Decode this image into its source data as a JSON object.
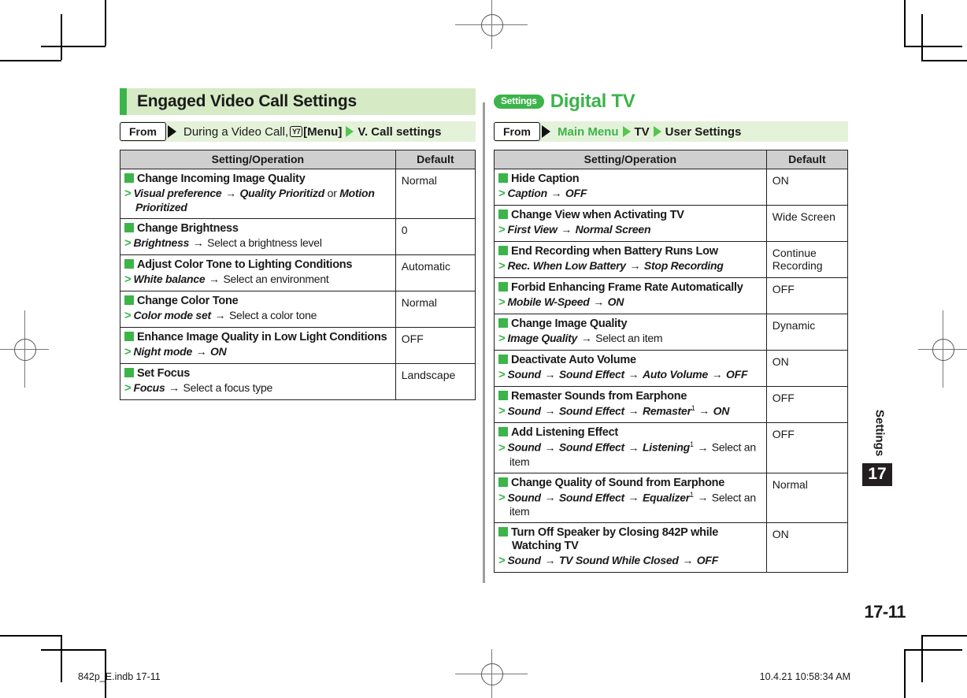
{
  "page": {
    "number": "17-11",
    "side_tab_label": "Settings",
    "side_tab_number": "17",
    "footer_left": "842p_E.indb   17-11",
    "footer_right": "10.4.21   10:58:34 AM"
  },
  "colors": {
    "accent_green": "#3cb44a",
    "band_green": "#d6ebc5",
    "from_band_green": "#e5f2da",
    "table_header_gray": "#cfcfcf",
    "rule_gray": "#9e9e9e",
    "ink": "#231f20"
  },
  "left_section": {
    "title": "Engaged Video Call Settings",
    "from": {
      "label": "From",
      "text_plain": "During a Video Call, ",
      "key_icon": "Y7",
      "menu_label": "[Menu]",
      "target": "V. Call settings"
    },
    "table": {
      "headers": [
        "Setting/Operation",
        "Default"
      ],
      "rows": [
        {
          "title": "Change Incoming Image Quality",
          "steps": [
            {
              "t": "Visual preference",
              "k": "bi"
            },
            {
              "t": "→",
              "k": "arr"
            },
            {
              "t": "Quality Prioritizd",
              "k": "bi"
            },
            {
              "t": " or ",
              "k": "plain"
            },
            {
              "t": "Motion Prioritized",
              "k": "bi"
            }
          ],
          "default": "Normal"
        },
        {
          "title": "Change Brightness",
          "steps": [
            {
              "t": "Brightness",
              "k": "bi"
            },
            {
              "t": "→",
              "k": "arr"
            },
            {
              "t": "Select a brightness level",
              "k": "plain"
            }
          ],
          "default": "0"
        },
        {
          "title": "Adjust Color Tone to Lighting Conditions",
          "steps": [
            {
              "t": "White balance",
              "k": "bi"
            },
            {
              "t": "→",
              "k": "arr"
            },
            {
              "t": "Select an environment",
              "k": "plain"
            }
          ],
          "default": "Automatic"
        },
        {
          "title": "Change Color Tone",
          "steps": [
            {
              "t": "Color mode set",
              "k": "bi"
            },
            {
              "t": "→",
              "k": "arr"
            },
            {
              "t": "Select a color tone",
              "k": "plain"
            }
          ],
          "default": "Normal"
        },
        {
          "title": "Enhance Image Quality in Low Light Conditions",
          "steps": [
            {
              "t": "Night mode",
              "k": "bi"
            },
            {
              "t": "→",
              "k": "arr"
            },
            {
              "t": "ON",
              "k": "bi"
            }
          ],
          "default": "OFF"
        },
        {
          "title": "Set Focus",
          "steps": [
            {
              "t": "Focus",
              "k": "bi"
            },
            {
              "t": "→",
              "k": "arr"
            },
            {
              "t": "Select a focus type",
              "k": "plain"
            }
          ],
          "default": "Landscape"
        }
      ]
    }
  },
  "right_section": {
    "badge": "Settings",
    "title": "Digital TV",
    "from": {
      "label": "From",
      "crumb1": "Main Menu",
      "crumb2": "TV",
      "crumb3": "User Settings"
    },
    "table": {
      "headers": [
        "Setting/Operation",
        "Default"
      ],
      "rows": [
        {
          "title": "Hide Caption",
          "steps": [
            {
              "t": "Caption",
              "k": "bi"
            },
            {
              "t": "→",
              "k": "arr"
            },
            {
              "t": "OFF",
              "k": "bi"
            }
          ],
          "default": "ON"
        },
        {
          "title": "Change View when Activating TV",
          "steps": [
            {
              "t": "First View",
              "k": "bi"
            },
            {
              "t": "→",
              "k": "arr"
            },
            {
              "t": "Normal Screen",
              "k": "bi"
            }
          ],
          "default": "Wide Screen"
        },
        {
          "title": "End Recording when Battery Runs Low",
          "steps": [
            {
              "t": "Rec. When Low Battery",
              "k": "bi"
            },
            {
              "t": "→",
              "k": "arr"
            },
            {
              "t": "Stop Recording",
              "k": "bi"
            }
          ],
          "default": "Continue Recording"
        },
        {
          "title": "Forbid Enhancing Frame Rate Automatically",
          "steps": [
            {
              "t": "Mobile W-Speed",
              "k": "bi"
            },
            {
              "t": "→",
              "k": "arr"
            },
            {
              "t": "ON",
              "k": "bi"
            }
          ],
          "default": "OFF"
        },
        {
          "title": "Change Image Quality",
          "steps": [
            {
              "t": "Image Quality",
              "k": "bi"
            },
            {
              "t": "→",
              "k": "arr"
            },
            {
              "t": "Select an item",
              "k": "plain"
            }
          ],
          "default": "Dynamic"
        },
        {
          "title": "Deactivate Auto Volume",
          "steps": [
            {
              "t": "Sound",
              "k": "bi"
            },
            {
              "t": "→",
              "k": "arr"
            },
            {
              "t": "Sound Effect",
              "k": "bi"
            },
            {
              "t": "→",
              "k": "arr"
            },
            {
              "t": "Auto Volume",
              "k": "bi"
            },
            {
              "t": "→",
              "k": "arr"
            },
            {
              "t": "OFF",
              "k": "bi"
            }
          ],
          "default": "ON"
        },
        {
          "title": "Remaster Sounds from Earphone",
          "steps": [
            {
              "t": "Sound",
              "k": "bi"
            },
            {
              "t": "→",
              "k": "arr"
            },
            {
              "t": "Sound Effect",
              "k": "bi"
            },
            {
              "t": "→",
              "k": "arr"
            },
            {
              "t": "Remaster",
              "k": "bi"
            },
            {
              "t": "1",
              "k": "sup"
            },
            {
              "t": "→",
              "k": "arr"
            },
            {
              "t": "ON",
              "k": "bi"
            }
          ],
          "default": "OFF"
        },
        {
          "title": "Add Listening Effect",
          "steps": [
            {
              "t": "Sound",
              "k": "bi"
            },
            {
              "t": "→",
              "k": "arr"
            },
            {
              "t": "Sound Effect",
              "k": "bi"
            },
            {
              "t": "→",
              "k": "arr"
            },
            {
              "t": "Listening",
              "k": "bi"
            },
            {
              "t": "1",
              "k": "sup"
            },
            {
              "t": "→",
              "k": "arr"
            },
            {
              "t": "Select an item",
              "k": "plain"
            }
          ],
          "default": "OFF"
        },
        {
          "title": "Change Quality of Sound from Earphone",
          "steps": [
            {
              "t": "Sound",
              "k": "bi"
            },
            {
              "t": "→",
              "k": "arr"
            },
            {
              "t": "Sound Effect",
              "k": "bi"
            },
            {
              "t": "→",
              "k": "arr"
            },
            {
              "t": "Equalizer",
              "k": "bi"
            },
            {
              "t": "1",
              "k": "sup"
            },
            {
              "t": "→",
              "k": "arr"
            },
            {
              "t": "Select an item",
              "k": "plain"
            }
          ],
          "default": "Normal"
        },
        {
          "title": "Turn Off Speaker by Closing 842P while Watching TV",
          "steps": [
            {
              "t": "Sound",
              "k": "bi"
            },
            {
              "t": "→",
              "k": "arr"
            },
            {
              "t": "TV Sound While Closed",
              "k": "bi"
            },
            {
              "t": "→",
              "k": "arr"
            },
            {
              "t": "OFF",
              "k": "bi"
            }
          ],
          "default": "ON"
        }
      ]
    }
  }
}
